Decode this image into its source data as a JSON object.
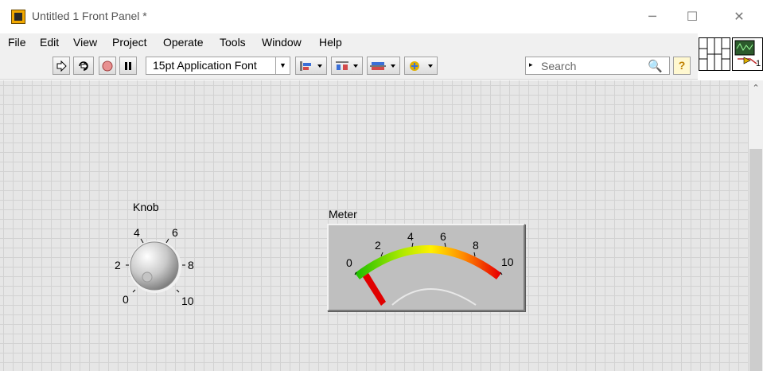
{
  "window": {
    "title": "Untitled 1 Front Panel *",
    "minimize": "─",
    "maximize": "☐",
    "close": "✕"
  },
  "menu": [
    "File",
    "Edit",
    "View",
    "Project",
    "Operate",
    "Tools",
    "Window",
    "Help"
  ],
  "toolbar": {
    "font": "15pt Application Font",
    "search_placeholder": "Search",
    "help": "?",
    "connector_index": "1"
  },
  "knob": {
    "label": "Knob",
    "ticks": [
      "0",
      "2",
      "4",
      "6",
      "8",
      "10"
    ],
    "value": 0
  },
  "meter": {
    "label": "Meter",
    "ticks": [
      "0",
      "2",
      "4",
      "6",
      "8",
      "10"
    ],
    "value": 0,
    "gradient_colors": [
      "#22c000",
      "#a6e800",
      "#fff000",
      "#ff8a00",
      "#e80000"
    ]
  }
}
